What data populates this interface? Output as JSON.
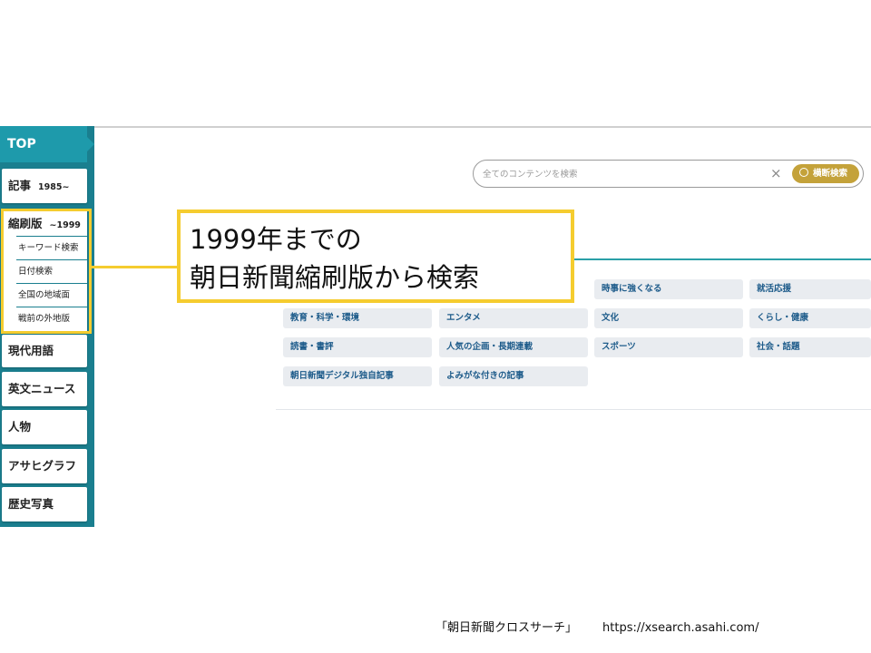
{
  "sidebar": {
    "top_label": "TOP",
    "items": [
      {
        "label": "記事",
        "sub": "1985~"
      },
      {
        "label": "縮刷版",
        "sub": "~1999"
      },
      {
        "label": "現代用語"
      },
      {
        "label": "英文ニュース"
      },
      {
        "label": "人物"
      },
      {
        "label": "アサヒグラフ"
      },
      {
        "label": "歴史写真"
      }
    ],
    "subitems": [
      "キーワード検索",
      "日付検索",
      "全国の地域面",
      "戦前の外地版"
    ]
  },
  "search": {
    "placeholder": "全てのコンテンツを検索",
    "clear_icon": "×",
    "button_label": "横断検索"
  },
  "categories": [
    "時事に強くなる",
    "就活応援",
    "教育・科学・環境",
    "エンタメ",
    "文化",
    "くらし・健康",
    "読書・書評",
    "人気の企画・長期連載",
    "スポーツ",
    "社会・話題",
    "朝日新聞デジタル独自記事",
    "よみがな付きの記事"
  ],
  "callout": {
    "line1": "1999年までの",
    "line2": "朝日新聞縮刷版から検索"
  },
  "caption": {
    "name": "「朝日新聞クロスサーチ」",
    "url": "https://xsearch.asahi.com/"
  },
  "colors": {
    "sidebar": "#1a7f8f",
    "sidebar_top": "#1e9aab",
    "accent_gold": "#c4a23a",
    "highlight_yellow": "#f5cc2f",
    "category_text": "#1d5b8a"
  }
}
